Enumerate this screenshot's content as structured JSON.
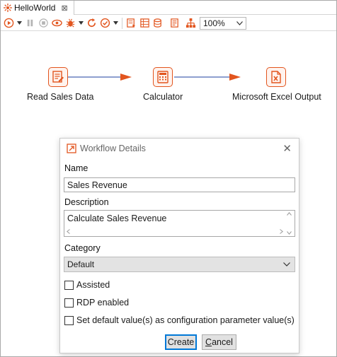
{
  "tab": {
    "title": "HelloWorld",
    "close_glyph": "⊠"
  },
  "toolbar": {
    "icons": [
      "run-icon",
      "pause-icon",
      "stop-icon",
      "preview-icon",
      "debug-icon",
      "replay-icon",
      "verify-icon",
      "sql-icon",
      "explore-db-icon",
      "database-icon",
      "show-results-icon",
      "layout-icon"
    ],
    "zoom_value": "100%"
  },
  "canvas": {
    "steps": [
      {
        "label": "Read Sales Data",
        "icon": "text-file-input-icon"
      },
      {
        "label": "Calculator",
        "icon": "calculator-icon"
      },
      {
        "label": "Microsoft Excel Output",
        "icon": "excel-output-icon"
      }
    ],
    "accent_color": "#e2551e"
  },
  "dialog": {
    "title": "Workflow Details",
    "close_glyph": "✕",
    "name_label": "Name",
    "name_value": "Sales Revenue",
    "description_label": "Description",
    "description_value": "Calculate Sales Revenue",
    "category_label": "Category",
    "category_value": "Default",
    "checkboxes": [
      {
        "label": "Assisted",
        "checked": false
      },
      {
        "label": "RDP enabled",
        "checked": false
      },
      {
        "label": "Set default value(s) as configuration parameter value(s)",
        "checked": false
      }
    ],
    "create_label": "Create",
    "cancel_label": "Cancel",
    "cancel_mnemonic": "C",
    "cancel_rest": "ancel"
  }
}
